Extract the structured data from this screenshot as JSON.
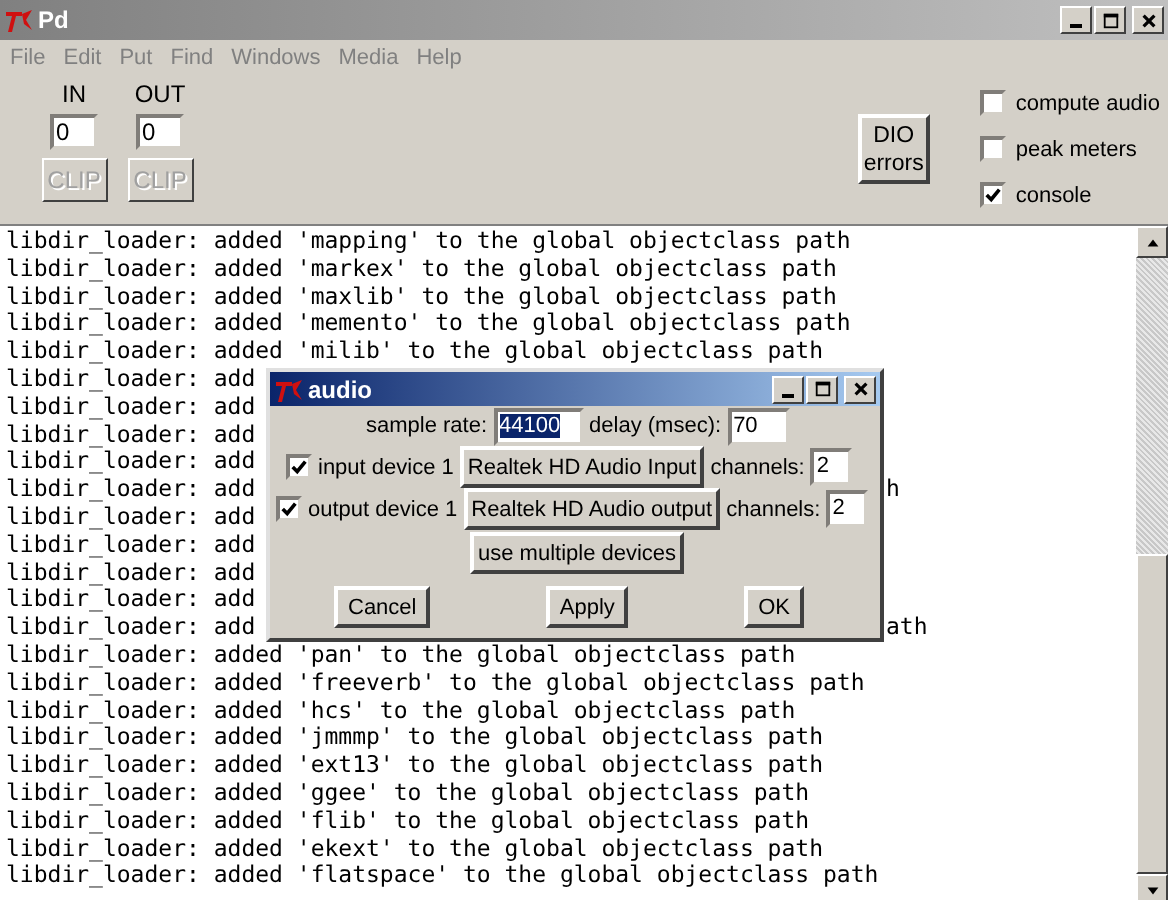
{
  "window": {
    "title": "Pd"
  },
  "menu": [
    "File",
    "Edit",
    "Put",
    "Find",
    "Windows",
    "Media",
    "Help"
  ],
  "io": [
    {
      "label": "IN",
      "value": "0",
      "clip": {
        "label": "CLIP",
        "disabled": true
      }
    },
    {
      "label": "OUT",
      "value": "0",
      "clip": {
        "label": "CLIP",
        "disabled": true
      }
    }
  ],
  "dio_button": {
    "lines": [
      "DIO",
      "errors"
    ]
  },
  "checkboxes": [
    {
      "label": "compute audio",
      "checked": false
    },
    {
      "label": "peak meters",
      "checked": false
    },
    {
      "label": "console",
      "checked": true
    }
  ],
  "console": {
    "lines": [
      {
        "kind": "full",
        "text": "libdir_loader: added 'mapping' to the global objectclass path"
      },
      {
        "kind": "full",
        "text": "libdir_loader: added 'markex' to the global objectclass path"
      },
      {
        "kind": "full",
        "text": "libdir_loader: added 'maxlib' to the global objectclass path"
      },
      {
        "kind": "full",
        "text": "libdir_loader: added 'memento' to the global objectclass path"
      },
      {
        "kind": "full",
        "text": "libdir_loader: added 'milib' to the global objectclass path"
      },
      {
        "kind": "partial",
        "text": "libdir_loader: add"
      },
      {
        "kind": "partial",
        "text": "libdir_loader: add"
      },
      {
        "kind": "partial",
        "text": "libdir_loader: add"
      },
      {
        "kind": "partial",
        "text": "libdir_loader: add"
      },
      {
        "kind": "partial",
        "text": "libdir_loader: add",
        "tail": "h"
      },
      {
        "kind": "partial",
        "text": "libdir_loader: add"
      },
      {
        "kind": "partial",
        "text": "libdir_loader: add"
      },
      {
        "kind": "partial",
        "text": "libdir_loader: add"
      },
      {
        "kind": "partial",
        "text": "libdir_loader: add"
      },
      {
        "kind": "partial",
        "text": "libdir_loader: add",
        "tail": "ath"
      },
      {
        "kind": "full",
        "text": "libdir_loader: added 'pan' to the global objectclass path"
      },
      {
        "kind": "full",
        "text": "libdir_loader: added 'freeverb' to the global objectclass path"
      },
      {
        "kind": "full",
        "text": "libdir_loader: added 'hcs' to the global objectclass path"
      },
      {
        "kind": "full",
        "text": "libdir_loader: added 'jmmmp' to the global objectclass path"
      },
      {
        "kind": "full",
        "text": "libdir_loader: added 'ext13' to the global objectclass path"
      },
      {
        "kind": "full",
        "text": "libdir_loader: added 'ggee' to the global objectclass path"
      },
      {
        "kind": "full",
        "text": "libdir_loader: added 'flib' to the global objectclass path"
      },
      {
        "kind": "full",
        "text": "libdir_loader: added 'ekext' to the global objectclass path"
      },
      {
        "kind": "full",
        "text": "libdir_loader: added 'flatspace' to the global objectclass path"
      }
    ]
  },
  "dialog": {
    "title": "audio",
    "sample_rate": {
      "label": "sample rate:",
      "value": "44100",
      "selected": true
    },
    "delay": {
      "label": "delay (msec):",
      "value": "70"
    },
    "devices": [
      {
        "label": "input device 1",
        "checked": true,
        "device": "Realtek HD Audio Input",
        "channels_label": "channels:",
        "channels": "2"
      },
      {
        "label": "output device 1",
        "checked": true,
        "device": "Realtek HD Audio output",
        "channels_label": "channels:",
        "channels": "2"
      }
    ],
    "multi_button": "use multiple devices",
    "buttons": [
      "Cancel",
      "Apply",
      "OK"
    ]
  }
}
